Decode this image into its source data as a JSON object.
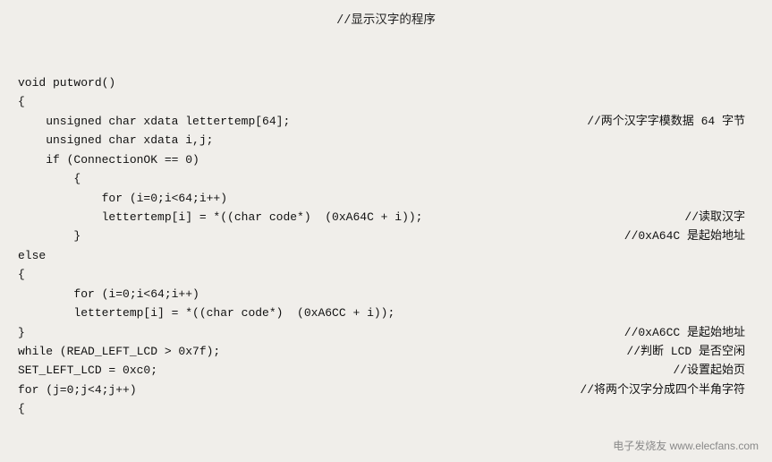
{
  "header": {
    "comment": "//显示汉字的程序"
  },
  "lines": [
    {
      "code": "void putword()",
      "comment": ""
    },
    {
      "code": "{",
      "comment": ""
    },
    {
      "code": "    unsigned char xdata lettertemp[64];",
      "comment": "//两个汉字字模数据 64 字节"
    },
    {
      "code": "    unsigned char xdata i,j;",
      "comment": ""
    },
    {
      "code": "    if (ConnectionOK == 0)",
      "comment": ""
    },
    {
      "code": "        {",
      "comment": ""
    },
    {
      "code": "            for (i=0;i<64;i++)",
      "comment": ""
    },
    {
      "code": "            lettertemp[i] = *((char code*)  (0xA64C + i));",
      "comment": "//读取汉字"
    },
    {
      "code": "        }",
      "comment": "//0xA64C 是起始地址"
    },
    {
      "code": "else",
      "comment": ""
    },
    {
      "code": "{",
      "comment": ""
    },
    {
      "code": "        for (i=0;i<64;i++)",
      "comment": ""
    },
    {
      "code": "        lettertemp[i] = *((char code*)  (0xA6CC + i));",
      "comment": ""
    },
    {
      "code": "}",
      "comment": "//0xA6CC 是起始地址"
    },
    {
      "code": "while (READ_LEFT_LCD > 0x7f);",
      "comment": "//判断 LCD 是否空闲"
    },
    {
      "code": "SET_LEFT_LCD = 0xc0;",
      "comment": "//设置起始页"
    },
    {
      "code": "for (j=0;j<4;j++)",
      "comment": "//将两个汉字分成四个半角字符"
    },
    {
      "code": "{",
      "comment": ""
    }
  ],
  "watermark": "电子发烧友 www.elecfans.com"
}
